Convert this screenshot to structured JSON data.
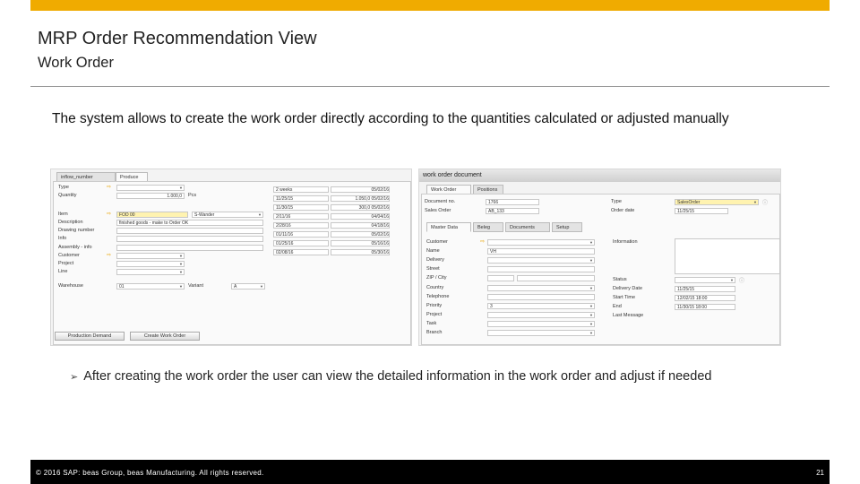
{
  "slide": {
    "title": "MRP Order Recommendation View",
    "subtitle": "Work Order",
    "body_text": "The system allows to create the work order directly according to the quantities calculated or adjusted manually",
    "bullet": "After creating the work order the user can view the detailed information in the work order and adjust if needed",
    "footer_copyright": "© 2016 SAP: beas Group, beas Manufacturing. All rights reserved.",
    "page_number": "21"
  },
  "left_window": {
    "tabs": [
      "inflow_number",
      "Produce"
    ],
    "rows": [
      {
        "label": "Type",
        "value": "",
        "dropdown": true
      },
      {
        "label": "Quantity",
        "value": "1.000,0",
        "unit": "Pcs"
      },
      {
        "label": "",
        "value": ""
      },
      {
        "label": "Item",
        "value": "FOD 00",
        "extra": "S-Wander"
      },
      {
        "label": "Description",
        "value": "finished goods - make to Order OK"
      },
      {
        "label": "Drawing number",
        "value": ""
      },
      {
        "label": "Info",
        "value": ""
      },
      {
        "label": "Assembly - info",
        "value": ""
      },
      {
        "label": "Customer",
        "value": ""
      },
      {
        "label": "Project",
        "value": ""
      },
      {
        "label": "Line",
        "value": ""
      },
      {
        "label": "Warehouse",
        "value": "01",
        "variant_label": "Variant",
        "variant_value": "A"
      }
    ],
    "right_list": [
      {
        "a": "2 weeks",
        "b": "05/02/16"
      },
      {
        "a": "11/25/15",
        "b": "1.050,0 05/02/16"
      },
      {
        "a": "11/30/15",
        "b": "300,0 05/02/16"
      },
      {
        "a": "2/11/16",
        "b": "04/04/16"
      },
      {
        "a": "2/28/16",
        "b": "04/18/16"
      },
      {
        "a": "01/11/16",
        "b": "05/02/16"
      },
      {
        "a": "01/25/16",
        "b": "05/16/16"
      },
      {
        "a": "02/08/16",
        "b": "05/30/16"
      }
    ],
    "buttons": [
      "Production Demand",
      "Create Work Order"
    ]
  },
  "right_window": {
    "header": "work order document",
    "tabs": [
      "Work Order",
      "Positions"
    ],
    "doc_no_label": "Document no.",
    "doc_no_value": "1766",
    "sales_order_label": "Sales Order",
    "sales_order_value": "AB_133",
    "type_label": "Type",
    "type_value": "SalesOrder",
    "order_date_label": "Order date",
    "order_date_value": "11/25/15",
    "subtabs": [
      "Master Data",
      "Beleg",
      "Documents",
      "Setup"
    ],
    "fields": [
      {
        "label": "Customer",
        "value": ""
      },
      {
        "label": "Name",
        "value": "VH"
      },
      {
        "label": "Delivery",
        "value": ""
      },
      {
        "label": "Street",
        "value": ""
      },
      {
        "label": "ZIP / City",
        "value": ""
      },
      {
        "label": "Country",
        "value": ""
      },
      {
        "label": "Telephone",
        "value": ""
      },
      {
        "label": "Priority",
        "value": "3"
      },
      {
        "label": "Project",
        "value": ""
      },
      {
        "label": "Task",
        "value": ""
      },
      {
        "label": "Branch",
        "value": ""
      }
    ],
    "info_label": "Information",
    "status_fields": [
      {
        "label": "Status",
        "value": ""
      },
      {
        "label": "Delivery Date",
        "value": "11/25/15"
      },
      {
        "label": "Start Time",
        "value": "12/02/15 18:00"
      },
      {
        "label": "End",
        "value": "11/30/15 18:00"
      },
      {
        "label": "Last Message",
        "value": ""
      }
    ]
  },
  "colors": {
    "accent": "#f0ab00",
    "footer_bg": "#000000"
  }
}
